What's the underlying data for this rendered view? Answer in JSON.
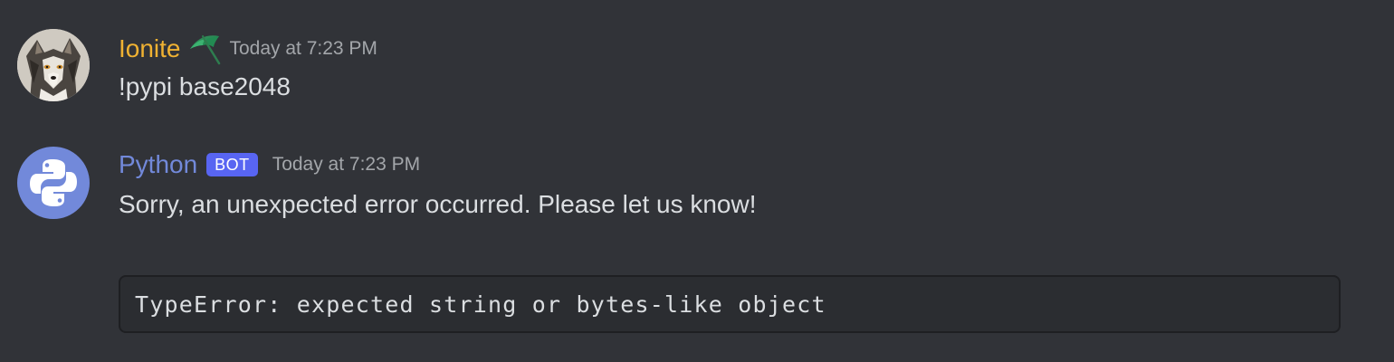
{
  "messages": [
    {
      "author": "Ionite",
      "author_color": "#f0b232",
      "decoration_icon": "umbrella-emoji",
      "timestamp": "Today at 7:23 PM",
      "text": "!pypi base2048",
      "avatar_icon": "wolf-avatar"
    },
    {
      "author": "Python",
      "author_color": "#7289da",
      "badge": "BOT",
      "badge_color": "#5865f2",
      "timestamp": "Today at 7:23 PM",
      "text": "Sorry, an unexpected error occurred. Please let us know!",
      "code": "TypeError: expected string or bytes-like object",
      "avatar_icon": "python-logo-avatar"
    }
  ],
  "colors": {
    "background": "#313338",
    "text": "#dbdee1",
    "timestamp": "#a3a6aa",
    "codeblock_bg": "#2b2d31"
  }
}
